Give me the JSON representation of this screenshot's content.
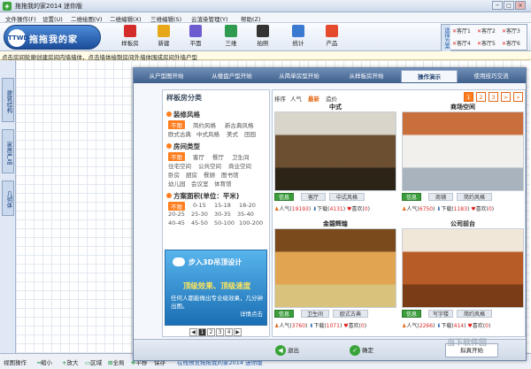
{
  "window": {
    "title": "拖拖我的家2014 迷你版",
    "buttons": [
      "─",
      "□",
      "×"
    ]
  },
  "menu": [
    "文件操作(F)",
    "设置(U)",
    "二维绘图(V)",
    "二维编辑(X)",
    "三维编辑(S)",
    "云渲染管理(Y)",
    "帮助(Z)"
  ],
  "toolbar": {
    "logo_text": "拖拖我的家",
    "logo_badge": "TTWD",
    "tools": [
      {
        "label": "样板房",
        "icon": "flag-icon",
        "color": "#d42b2b"
      },
      {
        "label": "新建",
        "icon": "new-file-icon",
        "color": "#e6a817"
      },
      {
        "label": "平面",
        "icon": "floorplan-icon",
        "color": "#6d5bd0"
      },
      {
        "label": "三维",
        "icon": "3d-view-icon",
        "color": "#2e9b4f"
      },
      {
        "label": "拍照",
        "icon": "camera-icon",
        "color": "#333333"
      },
      {
        "label": "统计",
        "icon": "statistics-icon",
        "color": "#3b7ad1"
      },
      {
        "label": "产品",
        "icon": "product-icon",
        "color": "#e44a2b"
      }
    ]
  },
  "recent": {
    "tag": "选择方案",
    "items": [
      "客厅1",
      "客厅2",
      "客厅3",
      "客厅4",
      "客厅5",
      "客厅6"
    ]
  },
  "hint": "点击房间轮廓创建房间内墙墙体，点击墙体绘制房间外墙体围成房间外墙户型",
  "side_tabs": [
    "建筑结构",
    "家居产品",
    "几何体"
  ],
  "status": {
    "mode": "视图操作",
    "zoom_out": "缩小",
    "zoom_in": "放大",
    "region": "区域",
    "all": "全局",
    "pan": "平移",
    "save": "保存",
    "preview": "在线预览拖拖我的家2014 迷你版"
  },
  "dialog": {
    "tabs": [
      "从户型图开始",
      "从楼盘户型开始",
      "从简单房型开始",
      "从样板房开始",
      "操作演示",
      "使用技巧交流"
    ],
    "active_tab": 4,
    "category_title": "样板房分类",
    "sections": [
      {
        "title": "装修风格",
        "options": [
          "不限",
          "简约风格",
          "新古典风格",
          "欧式古典",
          "中式风格",
          "美式",
          "田园"
        ]
      },
      {
        "title": "房间类型",
        "options": [
          "不限",
          "客厅",
          "餐厅",
          "卫生间",
          "住宅空间",
          "公共空间",
          "商业空间",
          "卧房",
          "厨房",
          "餐顾",
          "图书馆",
          "幼儿园",
          "会议室",
          "体育馆"
        ]
      },
      {
        "title": "方案面积(单位：平米)",
        "options": [
          "不限",
          "0-15",
          "15-18",
          "18-20",
          "20-25",
          "25-30",
          "30-35",
          "35-40",
          "40-45",
          "45-50",
          "50-100",
          "100-200"
        ]
      }
    ],
    "promo": {
      "headline": "步入3D吊顶设计",
      "subheadline": "顶级效果、顶级速度",
      "body": "任何人都能做出专业级效果，几分钟出图。",
      "cta": "详情点击"
    },
    "promo_pager": [
      "◀",
      "1",
      "2",
      "3",
      "4",
      "▶"
    ],
    "sort": {
      "label": "排序",
      "options": [
        "人气",
        "最新",
        "造价"
      ],
      "active": 1
    },
    "pager": [
      "1",
      "2",
      "3",
      ">",
      "»"
    ],
    "cards": [
      {
        "name": "中式",
        "chips": [
          "信息",
          "客厅",
          "中式风格"
        ],
        "popularity": "19193",
        "downloads": "4131",
        "likes": "0",
        "palette": [
          "#6b4f30",
          "#d9d5ca",
          "#2d2418"
        ]
      },
      {
        "name": "商场空间",
        "chips": [
          "信息",
          "商铺",
          "简约风格"
        ],
        "popularity": "6750",
        "downloads": "1183",
        "likes": "0",
        "palette": [
          "#f1f0ed",
          "#c96f3b",
          "#a9b3bd"
        ]
      },
      {
        "name": "金碧辉煌",
        "chips": [
          "信息",
          "卫生间",
          "欧式古典"
        ],
        "popularity": "3760",
        "downloads": "1071",
        "likes": "0",
        "palette": [
          "#e1a451",
          "#7a4a1c",
          "#d9c27b"
        ]
      },
      {
        "name": "公司前台",
        "chips": [
          "信息",
          "写字楼",
          "简约风格"
        ],
        "popularity": "2266",
        "downloads": "414",
        "likes": "0",
        "palette": [
          "#b85c27",
          "#f1e7d9",
          "#7a3c16"
        ]
      }
    ],
    "stat_labels": {
      "popularity": "人气",
      "downloads": "下载",
      "likes": "喜欢"
    },
    "buttons": {
      "cancel": "退出",
      "confirm": "确定",
      "sim": "拟真开始"
    }
  },
  "watermark": "当下软件园"
}
